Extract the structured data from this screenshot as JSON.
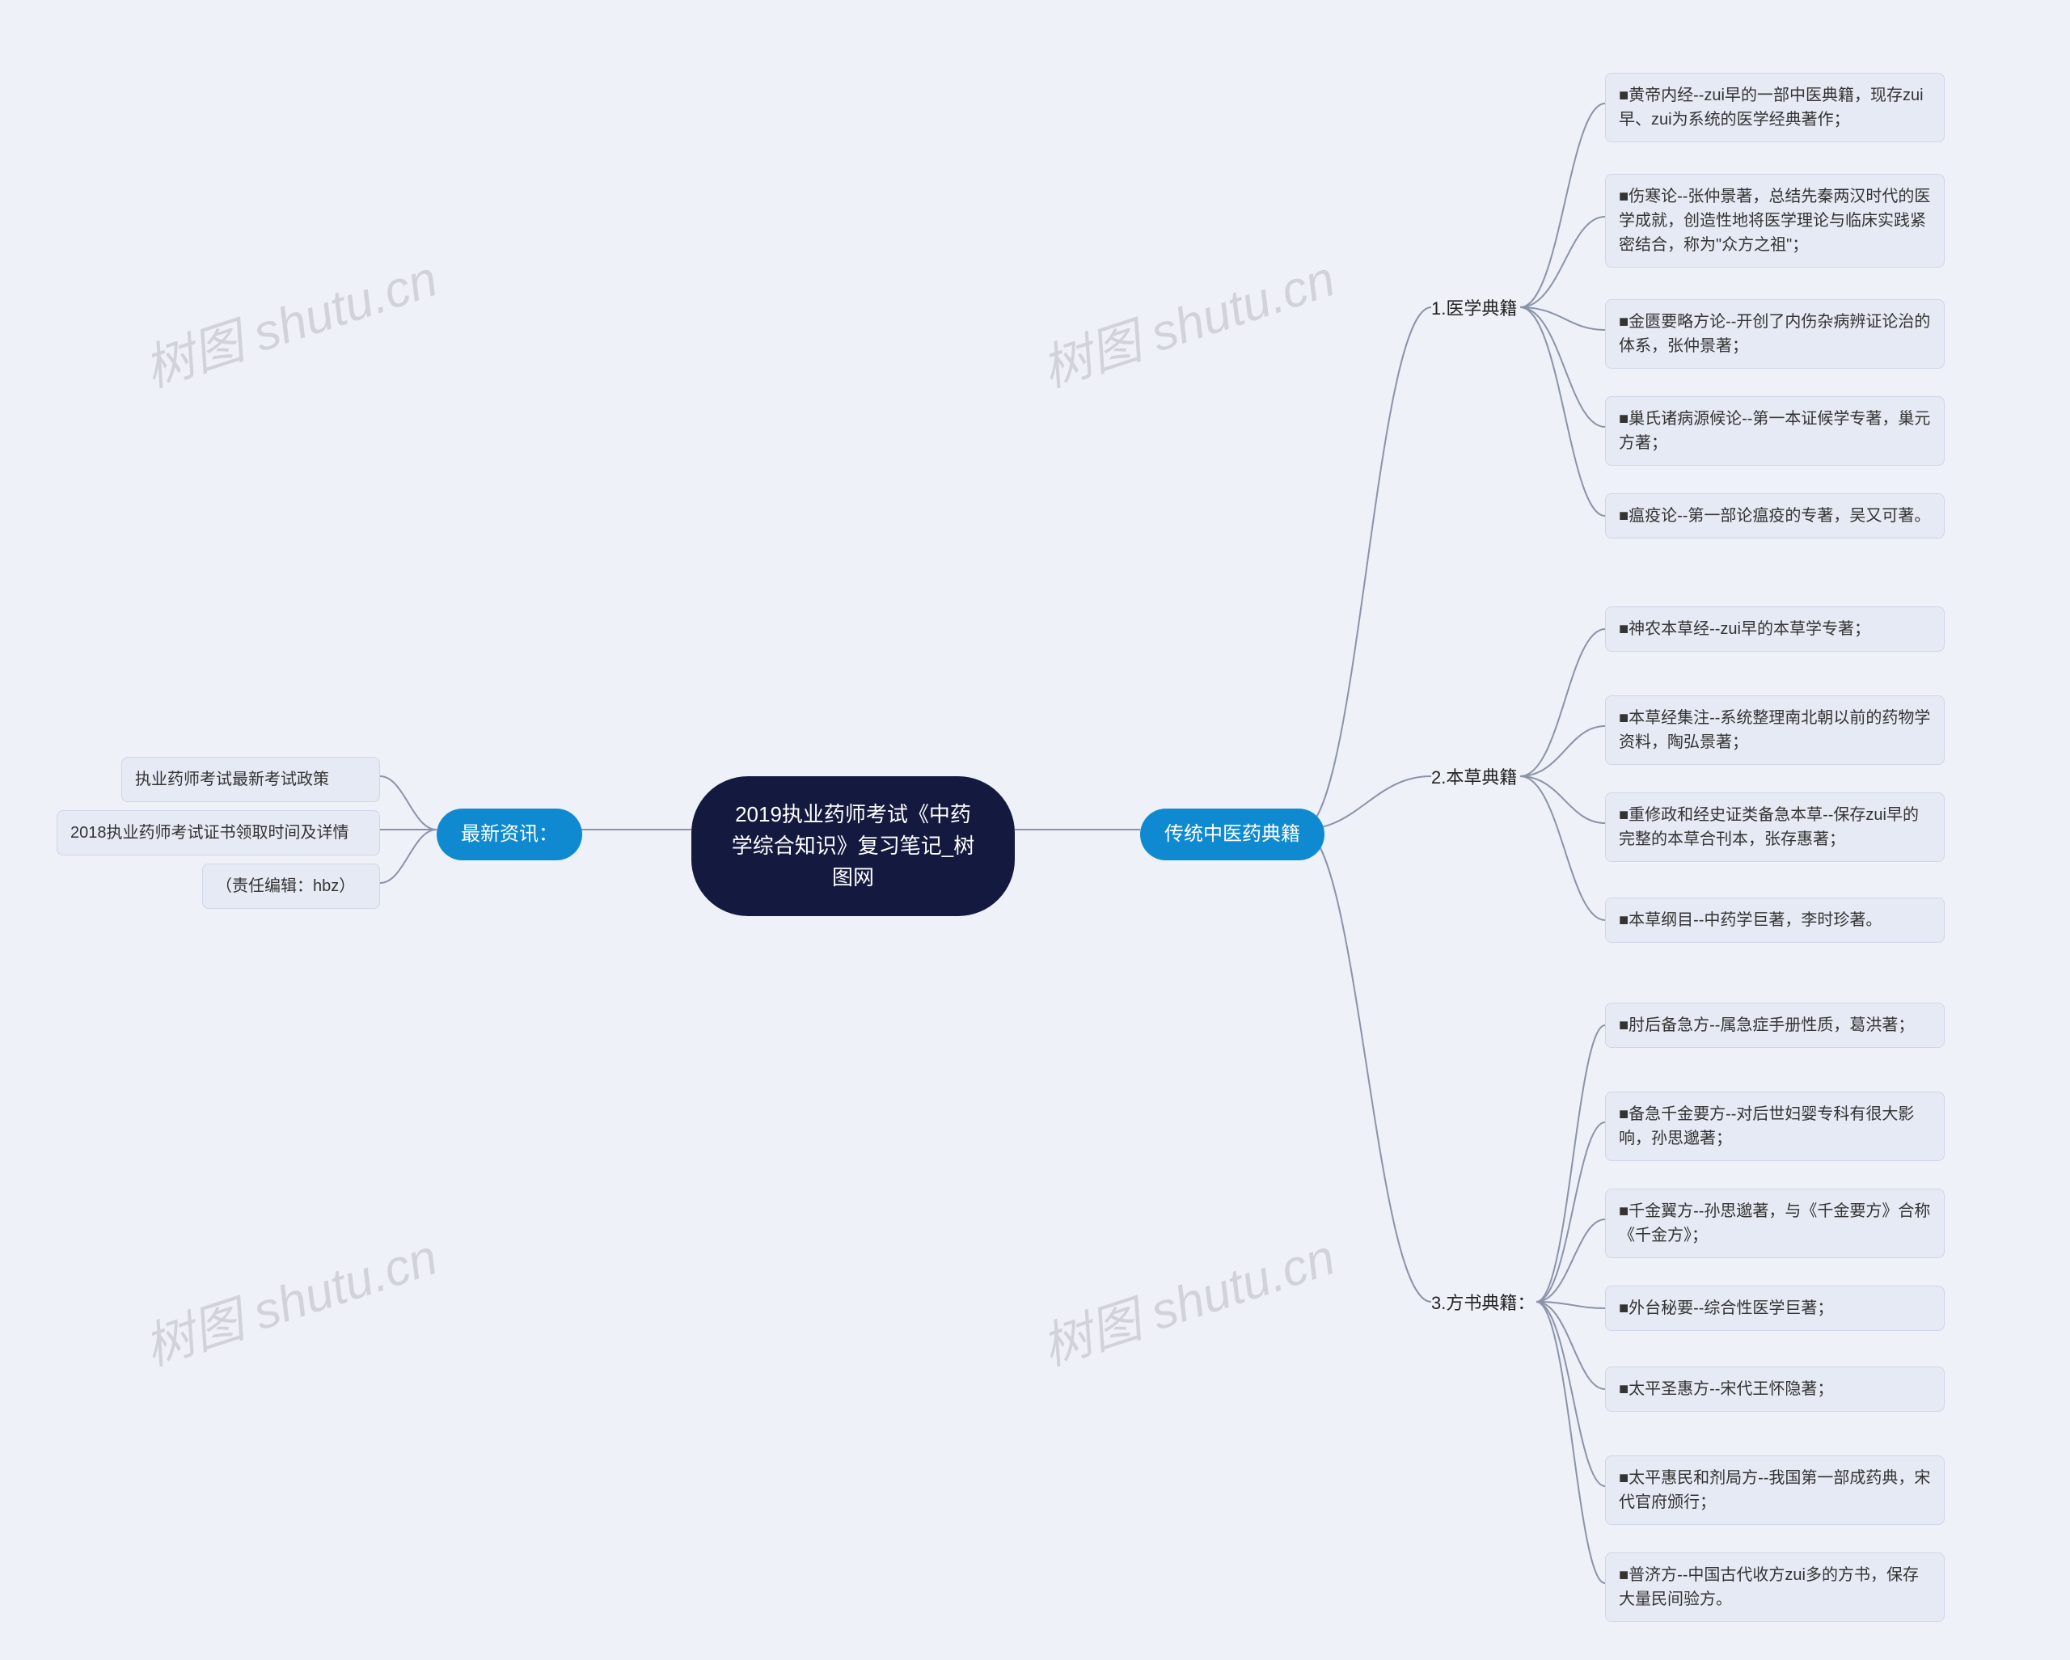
{
  "root": "2019执业药师考试《中药学综合知识》复习笔记_树图网",
  "left": {
    "branch": "最新资讯：",
    "items": [
      "执业药师考试最新考试政策",
      "2018执业药师考试证书领取时间及详情",
      "（责任编辑：hbz）"
    ]
  },
  "right": {
    "branch": "传统中医药典籍",
    "sections": [
      {
        "label": "1.医学典籍",
        "items": [
          "■黄帝内经--zui早的一部中医典籍，现存zui早、zui为系统的医学经典著作；",
          "■伤寒论--张仲景著，总结先秦两汉时代的医学成就，创造性地将医学理论与临床实践紧密结合，称为\"众方之祖\"；",
          "■金匮要略方论--开创了内伤杂病辨证论治的体系，张仲景著；",
          "■巢氏诸病源候论--第一本证候学专著，巢元方著；",
          "■瘟疫论--第一部论瘟疫的专著，吴又可著。"
        ]
      },
      {
        "label": "2.本草典籍",
        "items": [
          "■神农本草经--zui早的本草学专著；",
          "■本草经集注--系统整理南北朝以前的药物学资料，陶弘景著；",
          "■重修政和经史证类备急本草--保存zui早的完整的本草合刊本，张存惠著；",
          "■本草纲目--中药学巨著，李时珍著。"
        ]
      },
      {
        "label": "3.方书典籍：",
        "items": [
          "■肘后备急方--属急症手册性质，葛洪著；",
          "■备急千金要方--对后世妇婴专科有很大影响，孙思邈著；",
          "■千金翼方--孙思邈著，与《千金要方》合称《千金方》；",
          "■外台秘要--综合性医学巨著；",
          "■太平圣惠方--宋代王怀隐著；",
          "■太平惠民和剂局方--我国第一部成药典，宋代官府颁行；",
          "■普济方--中国古代收方zui多的方书，保存大量民间验方。"
        ]
      }
    ]
  },
  "watermark": "树图 shutu.cn"
}
